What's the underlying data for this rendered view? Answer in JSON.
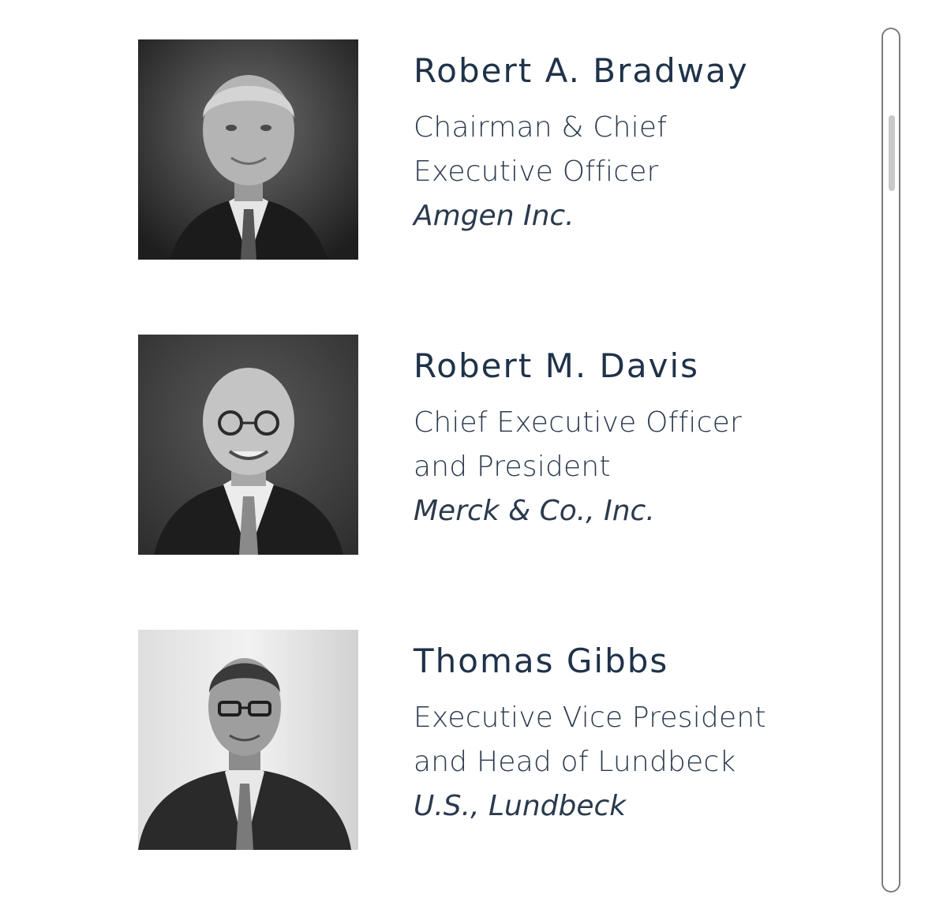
{
  "members": [
    {
      "name": "Robert A. Bradway",
      "title_lines": [
        "Chairman & Chief",
        "Executive Officer"
      ],
      "company": "Amgen Inc."
    },
    {
      "name": "Robert M. Davis",
      "title_lines": [
        "Chief Executive Officer",
        "and President"
      ],
      "company": "Merck & Co., Inc."
    },
    {
      "name": "Thomas Gibbs",
      "title_lines": [
        "Executive Vice President",
        "and Head of Lundbeck"
      ],
      "company": "U.S., Lundbeck"
    }
  ],
  "colors": {
    "name_text": "#1f3249",
    "body_text": "#2b3a4d",
    "scrollbar_border": "#7c7c7c",
    "scrollbar_thumb": "#c9c9c9"
  }
}
